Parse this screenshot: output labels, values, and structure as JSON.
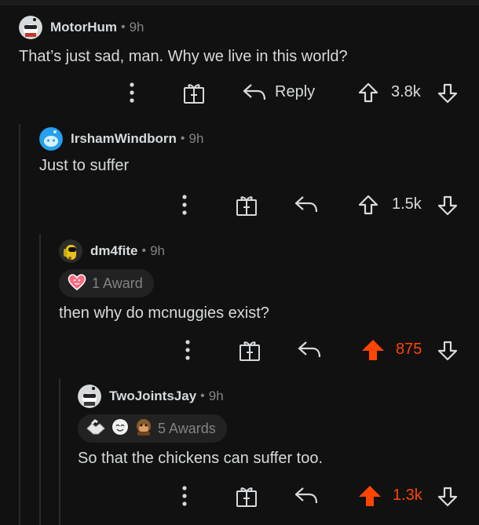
{
  "comments": [
    {
      "username": "MotorHum",
      "time": "9h",
      "text": "That’s just sad, man. Why we live in this world?",
      "reply_label": "Reply",
      "score": "3.8k",
      "upvoted": false
    },
    {
      "username": "IrshamWindborn",
      "time": "9h",
      "text": "Just to suffer",
      "score": "1.5k",
      "upvoted": false
    },
    {
      "username": "dm4fite",
      "time": "9h",
      "awards": "1 Award",
      "text": "then why do mcnuggies exist?",
      "score": "875",
      "upvoted": true
    },
    {
      "username": "TwoJointsJay",
      "time": "9h",
      "awards": "5 Awards",
      "text": "So that the chickens can suffer too.",
      "score": "1.3k",
      "upvoted": true
    }
  ],
  "separator": "•",
  "colors": {
    "upvote": "#ff4500",
    "text": "#d7dadc",
    "muted": "#818384",
    "background": "#111111"
  }
}
